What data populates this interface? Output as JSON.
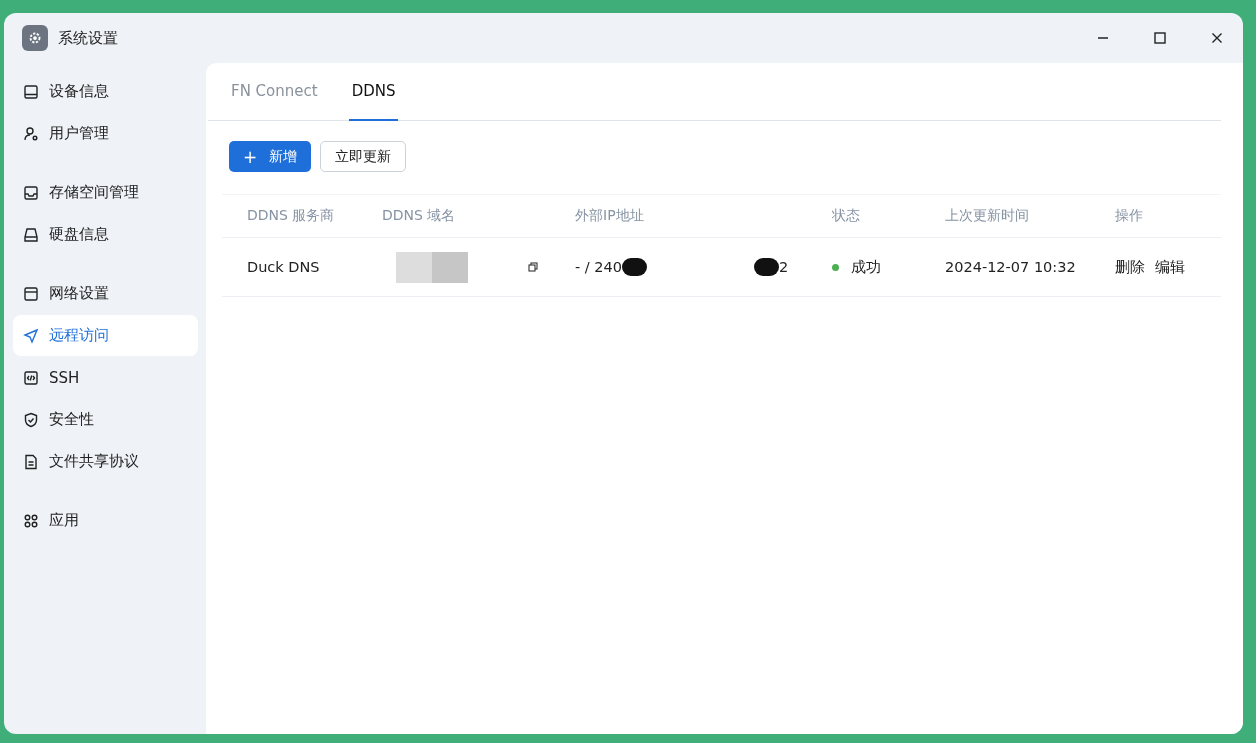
{
  "window": {
    "title": "系统设置"
  },
  "sidebar": {
    "groups": [
      {
        "items": [
          {
            "label": "设备信息",
            "kind": "device",
            "selected": false
          },
          {
            "label": "用户管理",
            "kind": "user",
            "selected": false
          }
        ]
      },
      {
        "items": [
          {
            "label": "存储空间管理",
            "kind": "storage",
            "selected": false
          },
          {
            "label": "硬盘信息",
            "kind": "disk",
            "selected": false
          }
        ]
      },
      {
        "items": [
          {
            "label": "网络设置",
            "kind": "network",
            "selected": false
          },
          {
            "label": "远程访问",
            "kind": "remote",
            "selected": true
          },
          {
            "label": "SSH",
            "kind": "ssh",
            "selected": false
          },
          {
            "label": "安全性",
            "kind": "shield",
            "selected": false
          },
          {
            "label": "文件共享协议",
            "kind": "file",
            "selected": false
          }
        ]
      },
      {
        "items": [
          {
            "label": "应用",
            "kind": "apps",
            "selected": false
          }
        ]
      }
    ]
  },
  "tabs": [
    {
      "label": "FN Connect",
      "selected": false
    },
    {
      "label": "DDNS",
      "selected": true
    }
  ],
  "toolbar": {
    "add_button": {
      "icon": "+",
      "label": "新增"
    },
    "update_button": "立即更新"
  },
  "table": {
    "columns": [
      "DDNS 服务商",
      "DDNS 域名",
      "外部IP地址",
      "状态",
      "上次更新时间",
      "操作"
    ],
    "rows": [
      {
        "provider": "Duck DNS",
        "ip_prefix": "- / 240",
        "ip_suffix": "2",
        "status": "成功",
        "color": "#4caf50",
        "updated": "2024-12-07 10:32",
        "actions": [
          "删除",
          "编辑"
        ]
      }
    ]
  }
}
